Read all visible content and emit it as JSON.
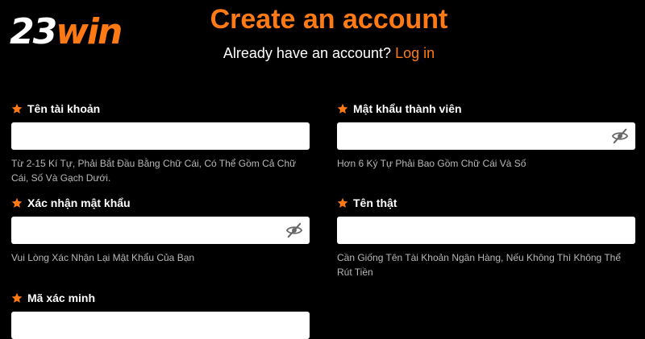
{
  "brand": {
    "logo_number": "23",
    "logo_word": "win"
  },
  "header": {
    "title": "Create an account",
    "subtitle": "Already have an account?",
    "login_link": "Log in"
  },
  "fields": {
    "username": {
      "label": "Tên tài khoản",
      "value": "",
      "hint": "Từ 2-15 Kí Tự, Phải Bắt Đầu Bằng Chữ Cái, Có Thể Gồm Cả Chữ Cái, Số Và Gạch Dưới."
    },
    "password": {
      "label": "Mật khẩu thành viên",
      "value": "",
      "hint": "Hơn 6 Ký Tự Phải Bao Gồm Chữ Cái Và Số"
    },
    "confirm_password": {
      "label": "Xác nhận mật khẩu",
      "value": "",
      "hint": "Vui Lòng Xác Nhận Lại Mật Khẩu Của Bạn"
    },
    "real_name": {
      "label": "Tên thật",
      "value": "",
      "hint": "Cần Giống Tên Tài Khoản Ngân Hàng, Nếu Không Thì Không Thể Rút Tiền"
    },
    "captcha": {
      "label": "Mã xác minh",
      "value": ""
    }
  },
  "icons": {
    "required": "star-icon",
    "password_toggle": "eye-slash-icon"
  },
  "colors": {
    "accent": "#ff7a14",
    "background": "#000000",
    "hint": "#b8b8b8",
    "input_bg": "#ffffff"
  }
}
